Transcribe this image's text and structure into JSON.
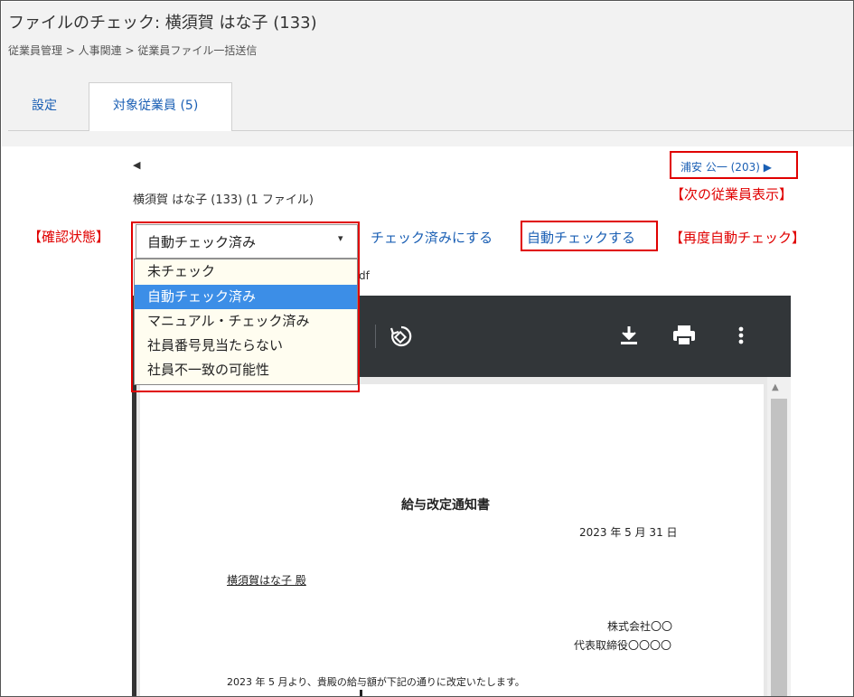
{
  "page": {
    "title": "ファイルのチェック: 横須賀 はな子 (133)",
    "breadcrumb": "従業員管理 > 人事関連 > 従業員ファイル一括送信"
  },
  "tabs": {
    "setting": "設定",
    "target": "対象従業員 (5)"
  },
  "nav": {
    "prev_arrow": "◀",
    "next_link": "浦安 公一 (203) ▶"
  },
  "employee": {
    "info": "横須賀 はな子 (133) (1 ファイル)"
  },
  "controls": {
    "status_value": "自動チェック済み",
    "caret": "▾",
    "check_done": "チェック済みにする",
    "auto_check": "自動チェックする",
    "file_suffix": "df"
  },
  "dropdown": {
    "options": [
      {
        "label": "未チェック",
        "selected": false
      },
      {
        "label": "自動チェック済み",
        "selected": true
      },
      {
        "label": "マニュアル・チェック済み",
        "selected": false
      },
      {
        "label": "社員番号見当たらない",
        "selected": false
      },
      {
        "label": "社員不一致の可能性",
        "selected": false
      }
    ]
  },
  "annotations": {
    "status": "【確認状態】",
    "next_employee": "【次の従業員表示】",
    "recheck": "【再度自動チェック】",
    "color": "#e00000"
  },
  "viewer": {
    "scroll_up": "▲",
    "icons": [
      "rotate-icon",
      "download-icon",
      "print-icon",
      "more-icon"
    ]
  },
  "document": {
    "title": "給与改定通知書",
    "date": "2023 年 5 月 31 日",
    "addressee": "横須賀はな子  殿",
    "company": "株式会社〇〇",
    "signer": "代表取締役〇〇〇〇",
    "body": "2023 年 5 月より、貴殿の給与額が下記の通りに改定いたします。"
  },
  "colors": {
    "link": "#1a5fb4",
    "header_bg": "#f2f2f2",
    "selected_bg": "#3c8ee7",
    "toolbar_bg": "#323639"
  }
}
